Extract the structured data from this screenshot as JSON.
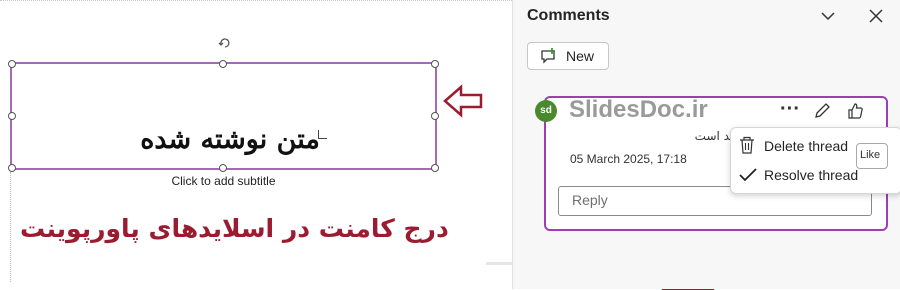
{
  "slide": {
    "title_text": "متن نوشته شده",
    "subtitle_placeholder": "Click to add subtitle",
    "caption": "درج کامنت در اسلایدهای پاورپوینت"
  },
  "comments_pane": {
    "title": "Comments",
    "new_button": "New",
    "thread": {
      "avatar_initials": "sd",
      "author": "SlidesDoc.ir",
      "more_label": "···",
      "body": "نظر در مورد اسلاید است",
      "timestamp": "05 March 2025, 17:18",
      "reply_placeholder": "Reply"
    },
    "context_menu": {
      "delete_label": "Delete thread",
      "resolve_label": "Resolve thread"
    },
    "tooltip": "Like"
  },
  "colors": {
    "selection_border": "#a36bb5",
    "card_border": "#9d3fb0",
    "annotation_red": "#9b1c31",
    "avatar_green": "#4a8a2c"
  },
  "icons": [
    "rotate-handle-icon",
    "chevron-down-icon",
    "close-icon",
    "new-comment-icon",
    "edit-icon",
    "like-icon",
    "trash-icon",
    "checkmark-icon",
    "arrow-left-annotation",
    "arrow-up-annotation"
  ]
}
